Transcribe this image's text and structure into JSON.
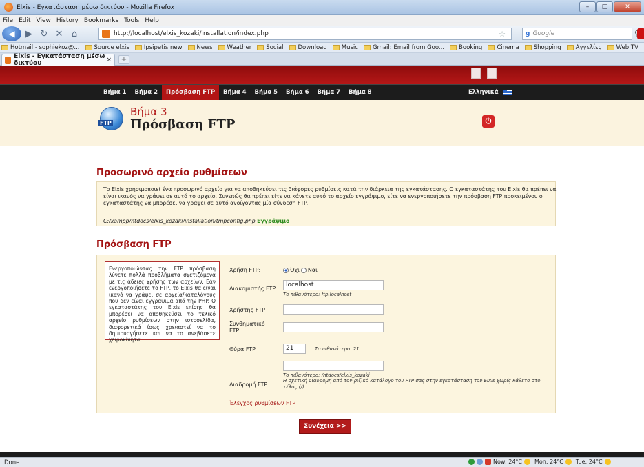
{
  "browser": {
    "window_title": "Elxis - Εγκατάσταση μέσω δικτύου - Mozilla Firefox",
    "menu": [
      "File",
      "Edit",
      "View",
      "History",
      "Bookmarks",
      "Tools",
      "Help"
    ],
    "url": "http://localhost/elxis_kozaki/installation/index.php",
    "search_placeholder": "Google",
    "bookmarks": [
      "Hotmail - sophiekoz@...",
      "Source elxis",
      "Ipsipetis new",
      "News",
      "Weather",
      "Social",
      "Download",
      "Music",
      "Gmail: Email from Goo...",
      "Booking",
      "Cinema",
      "Shopping",
      "Αγγελίες",
      "Web TV"
    ],
    "tab_title": "Elxis - Εγκατάσταση μέσω δικτύου",
    "status": "Done",
    "weather": [
      "Now: 24°C",
      "Mon: 24°C",
      "Tue: 24°C"
    ]
  },
  "site": {
    "steps": [
      "Βήμα 1",
      "Βήμα 2",
      "Πρόσβαση FTP",
      "Βήμα 4",
      "Βήμα 5",
      "Βήμα 6",
      "Βήμα 7",
      "Βήμα 8"
    ],
    "language": "Ελληνικά",
    "step_number": "Βήμα 3",
    "step_title": "Πρόσβαση FTP",
    "logo_badge": "FTP"
  },
  "tmp_section": {
    "title": "Προσωρινό αρχείο ρυθμίσεων",
    "text": "Το Elxis χρησιμοποιεί ένα προσωρινό αρχείο για να αποθηκεύσει τις διάφορες ρυθμίσεις κατά την διάρκεια της εγκατάστασης. Ο εγκαταστάτης του Elxis θα πρέπει να είναι ικανός να γράψει σε αυτό το αρχείο. Συνεπώς θα πρέπει είτε να κάνετε αυτό το αρχείο εγγράψιμο, είτε να ενεργοποιήσετε την πρόσβαση FTP προκειμένου ο εγκαταστάτης να μπορέσει να γράψει σε αυτό ανοίγοντας μία σύνδεση FTP.",
    "path": "C:/xampp/htdocs/elxis_kozaki/installation/tmpconfig.php",
    "status": "Εγγράψιμο"
  },
  "ftp_section": {
    "title": "Πρόσβαση FTP",
    "note": "Ενεργοποιώντας την FTP πρόσβαση λύνετε πολλά προβλήματα σχετιζόμενα με τις άδειες χρήσης των αρχείων. Εάν ενεργοποιήσετε το FTP, το Elxis θα είναι ικανό να γράψει σε αρχεία/καταλόγους που δεν είναι εγγράψιμα από την PHP. Ο εγκαταστάτης του Elxis επίσης θα μπορέσει να αποθηκεύσει το τελικό αρχείο ρυθμίσεων στην ιστοσελίδα, διαφορετικά ίσως χρειαστεί να το δημιουργήσετε και να το ανεβάσετε χειροκίνητα.",
    "use_label": "Χρήση FTP:",
    "opt_no": "Όχι",
    "opt_yes": "Ναι",
    "host_label": "Διακομιστής FTP",
    "host_value": "localhost",
    "host_hint": "Το πιθανότερο: ftp.localhost",
    "user_label": "Χρήστης FTP",
    "user_value": "",
    "pass_label": "Συνθηματικό FTP",
    "pass_value": "",
    "port_label": "Θύρα FTP",
    "port_value": "21",
    "port_hint": "Το πιθανότερο: 21",
    "path_label": "Διαδρομή FTP",
    "path_value": "",
    "path_hint1": "Το πιθανότερο: /htdocs/elxis_kozaki",
    "path_hint2": "Η σχετική διαδρομή από τον ριζικό κατάλογο του FTP σας στην εγκατάσταση του Elxis χωρίς κάθετο στο τέλος (/).",
    "check_link": "Έλεγχος ρυθμίσεων FTP",
    "continue": "Συνέχεια >>"
  }
}
